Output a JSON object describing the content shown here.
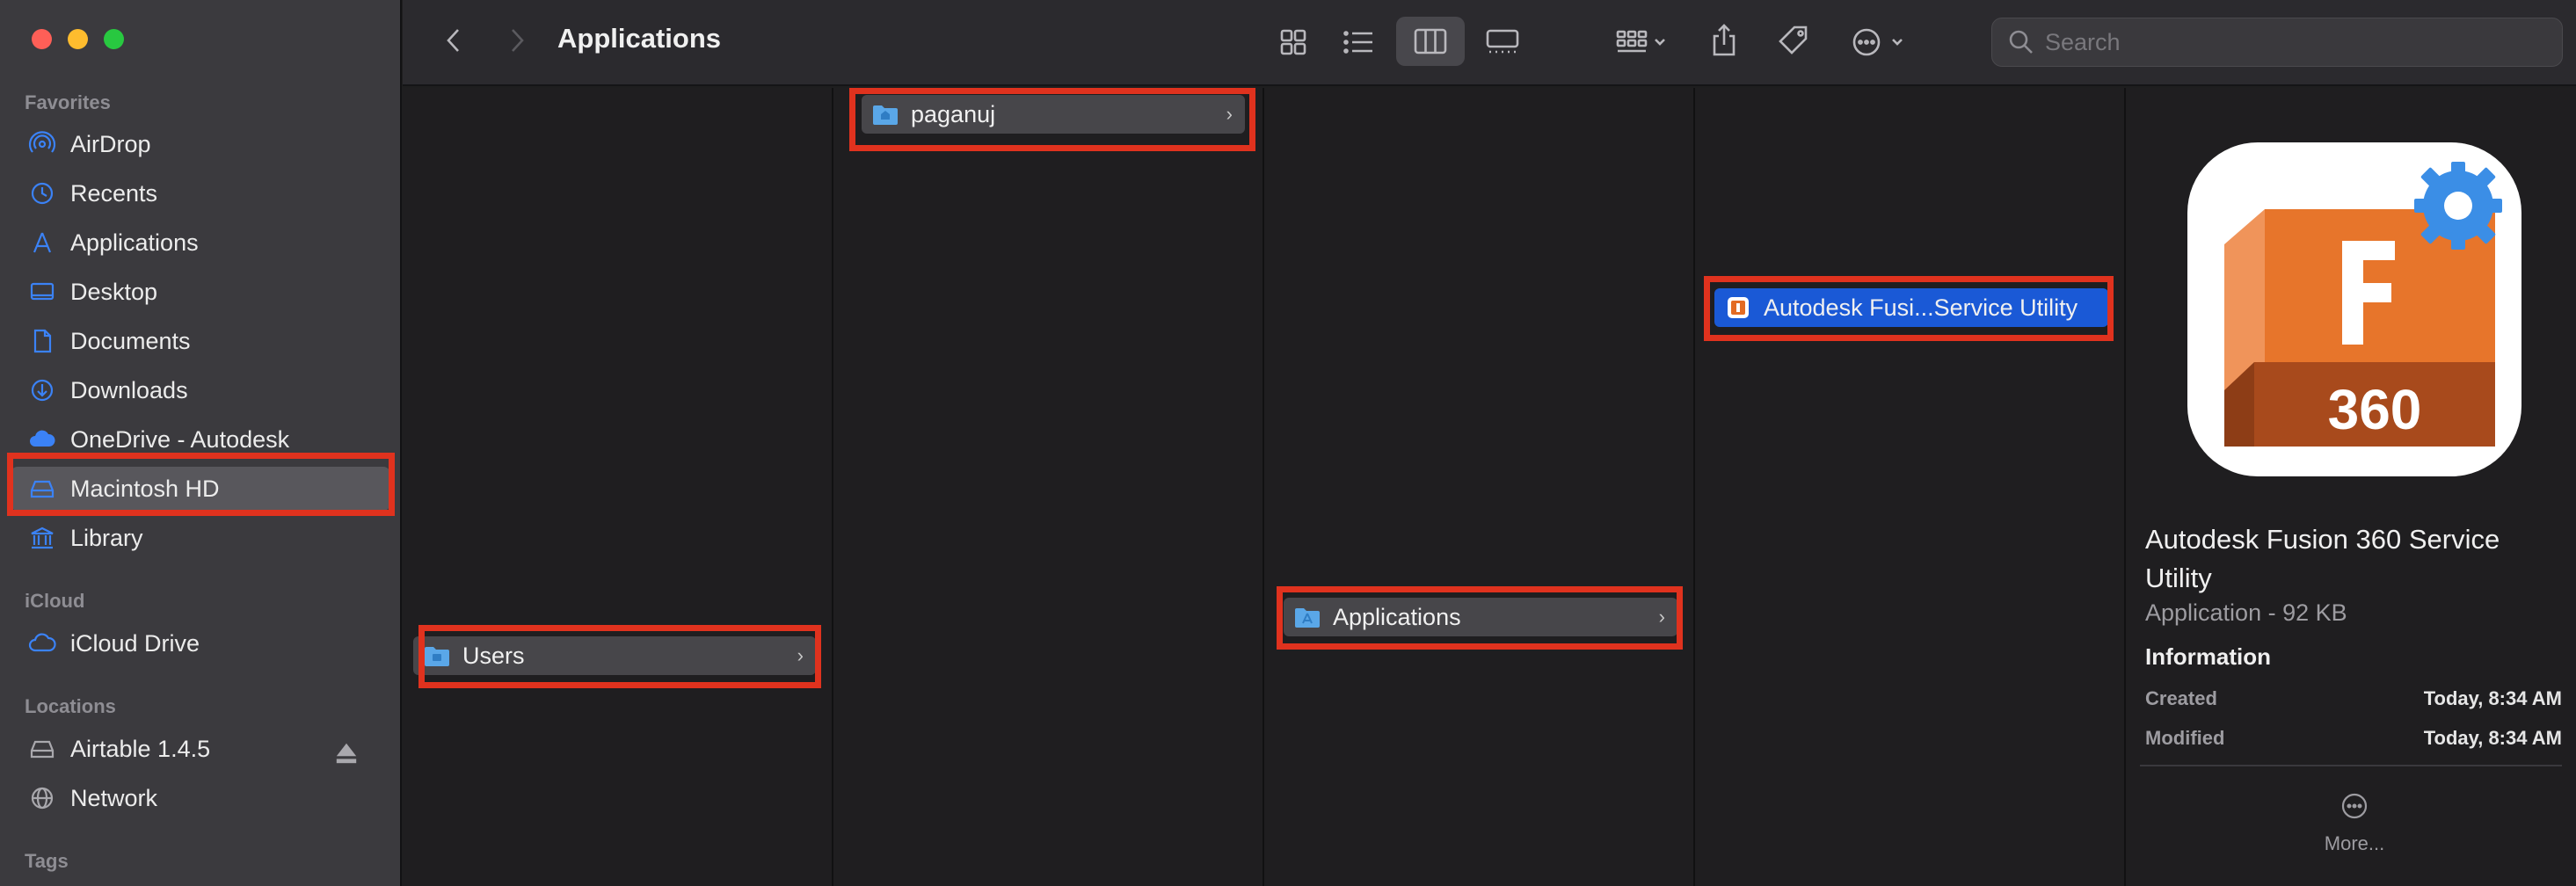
{
  "colors": {
    "highlight": "#e0321e",
    "selection": "#1a59d6",
    "accent_icon": "#3b82f6"
  },
  "window": {
    "title": "Applications"
  },
  "toolbar": {
    "back_icon": "chevron-left-icon",
    "forward_icon": "chevron-right-icon",
    "views": [
      "icon-view",
      "list-view",
      "column-view",
      "gallery-view"
    ],
    "active_view": "column-view",
    "search_placeholder": "Search"
  },
  "sidebar": {
    "favorites_label": "Favorites",
    "favorites": [
      {
        "label": "AirDrop",
        "icon": "airdrop-icon"
      },
      {
        "label": "Recents",
        "icon": "clock-icon"
      },
      {
        "label": "Applications",
        "icon": "applications-icon"
      },
      {
        "label": "Desktop",
        "icon": "desktop-icon"
      },
      {
        "label": "Documents",
        "icon": "document-icon"
      },
      {
        "label": "Downloads",
        "icon": "download-icon"
      },
      {
        "label": "OneDrive - Autodesk",
        "icon": "cloud-icon"
      },
      {
        "label": "Macintosh HD",
        "icon": "disk-icon",
        "selected": true
      },
      {
        "label": "Library",
        "icon": "library-icon"
      }
    ],
    "icloud_label": "iCloud",
    "icloud": [
      {
        "label": "iCloud Drive",
        "icon": "icloud-icon"
      }
    ],
    "locations_label": "Locations",
    "locations": [
      {
        "label": "Airtable 1.4.5",
        "icon": "disk-icon",
        "ejectable": true
      },
      {
        "label": "Network",
        "icon": "network-icon"
      }
    ],
    "tags_label": "Tags"
  },
  "columns": [
    {
      "item": "Users"
    },
    {
      "item": "paganuj"
    },
    {
      "item": "Applications"
    },
    {
      "item": "Autodesk Fusi...Service Utility"
    }
  ],
  "preview": {
    "icon_letter": "F",
    "icon_number": "360",
    "title": "Autodesk Fusion 360 Service Utility",
    "subtitle": "Application - 92 KB",
    "info_label": "Information",
    "created_label": "Created",
    "created_value": "Today, 8:34 AM",
    "modified_label": "Modified",
    "modified_value": "Today, 8:34 AM",
    "more_label": "More..."
  }
}
